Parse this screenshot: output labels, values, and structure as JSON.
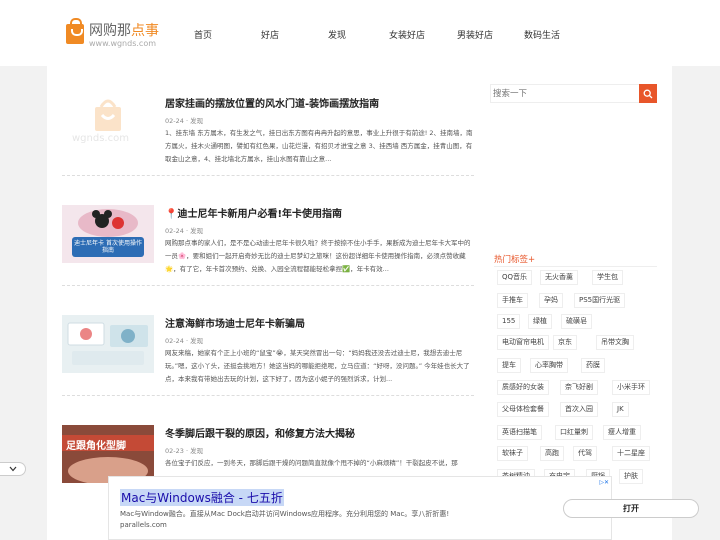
{
  "site": {
    "logo_name_a": "网购那",
    "logo_name_b": "点事",
    "logo_url": "www.wgnds.com",
    "logo_icon": "shopping-bag-icon"
  },
  "nav": [
    "首页",
    "好店",
    "发现",
    "女装好店",
    "男装好店",
    "数码生活"
  ],
  "articles": [
    {
      "title": "居家挂画的摆放位置的风水门道-装饰画摆放指南",
      "date": "02-24",
      "category": "发现",
      "summary": "1、挂东墙 东方属木，有生发之气，挂日出东方图有冉冉升起的意思，事业上升很于有前途! 2、挂南墙，南方属火，挂木火通明图，譬如有红色果，山花烂漫，有招贝才进宝之意 3、挂西墙 西方属金，挂青山图，有取金山之意，4、挂北墙北方属水，挂山水图有靠山之意...",
      "thumb_text": "wgnds.com"
    },
    {
      "title": "📍迪士尼年卡新用户必看!年卡使用指南",
      "date": "02-24",
      "category": "发现",
      "summary": "网购那点事的家人们，是不是心动迪士尼年卡很久啦？终于按捺不住小手手，果断成为迪士尼年卡大军中的一员🌸，要和姐们一起开启奇妙无比的迪士尼梦幻之旅咪！这份超详细年卡使用操作指南，必须点赞收藏🌟，有了它，年卡首次预约、兑换、入园全流程都能轻松拿捏✅，年卡有效...",
      "thumb_text": "迪士尼年卡 首次使用操作指南"
    },
    {
      "title": "注意海鲜市场迪士尼年卡新骗局",
      "date": "02-24",
      "category": "发现",
      "summary": "网友来稿，她家有个正上小班的“鼠宝”😭，某天突然冒出一句：“妈妈我还没去过迪士尼，我想去迪士尼玩。”嗯，这小丫头，还挺会挑地方！她这当妈的哪能拒绝呢，立马应道：“好呀，没问题。” 今年娃也长大了点，本来我有带她出去玩的计划，这下好了，因为这小妮子的强烈诉求，计划...",
      "thumb_text": ""
    },
    {
      "title": "冬季脚后跟干裂的原因，和修复方法大揭秘",
      "date": "02-23",
      "category": "发现",
      "summary": "各位宝子们反应，一到冬天，那脚后跟干燥的问题简直就像个甩不掉的“小麻烦精”！干裂起皮不说，那",
      "thumb_text": "足跟角化型脚"
    }
  ],
  "search": {
    "placeholder": "搜索一下",
    "button_icon": "search-icon"
  },
  "tags": {
    "title": "热门标签+",
    "items": [
      "QQ音乐",
      "无火香薰",
      "学生包",
      "手推车",
      "孕妈",
      "PS5国行光驱",
      "155",
      "绿植",
      "硫磺皂",
      "电动窗帘电机",
      "京东",
      "吊带文胸",
      "提车",
      "心率胸带",
      "药膜",
      "质感好的女装",
      "奈飞好剧",
      "小米手环",
      "父母体检套餐",
      "首次入园",
      "JK",
      "英语扫描笔",
      "口红量刺",
      "瘦人增重",
      "软袜子",
      "高跑",
      "代驾",
      "十二星座",
      "茶树精油",
      "充电宝",
      "厨锅",
      "护肤"
    ]
  },
  "ad": {
    "title": "Mac与Windows融合 - 七五折",
    "text": "Mac与Window融合。直接从Mac Dock启动并访问Windows应用程序。充分利用您的 Mac。享八折折惠! parallels.com",
    "button": "打开",
    "choices_icon": "ad-choices-icon",
    "collapse_icon": "chevron-down-icon"
  },
  "colors": {
    "accent": "#e8562a",
    "logo": "#f08a24",
    "link": "#1a0dab"
  }
}
